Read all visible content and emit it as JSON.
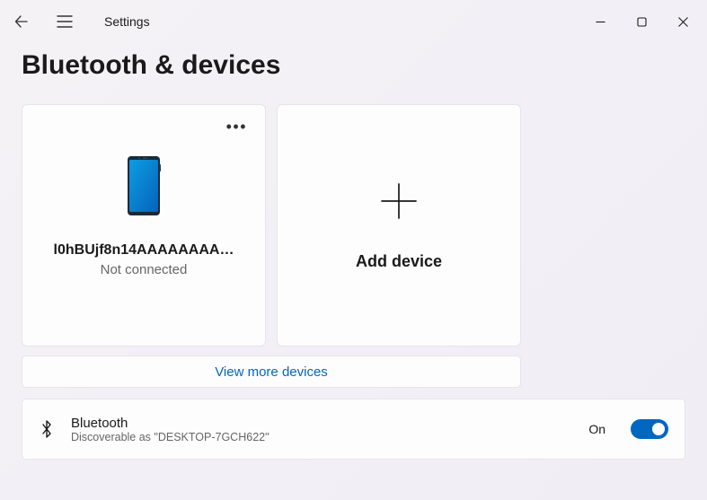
{
  "titlebar": {
    "app_name": "Settings"
  },
  "page": {
    "title": "Bluetooth & devices"
  },
  "device_card": {
    "name": "l0hBUjf8n14AAAAAAAA…",
    "status": "Not connected"
  },
  "add_card": {
    "label": "Add device"
  },
  "view_more": {
    "label": "View more devices"
  },
  "bluetooth_row": {
    "title": "Bluetooth",
    "subtitle": "Discoverable as \"DESKTOP-7GCH622\"",
    "toggle_state": "On"
  }
}
